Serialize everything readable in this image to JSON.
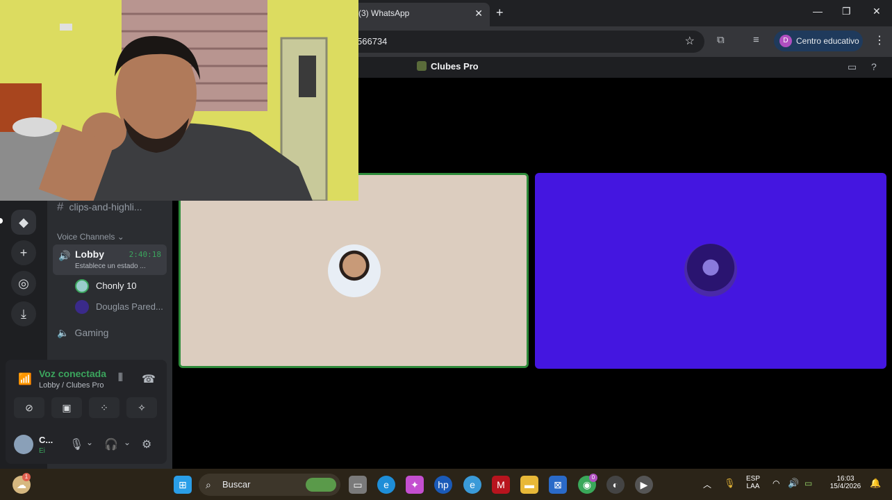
{
  "browser": {
    "tab_title": "(3) WhatsApp",
    "tab_close": "✕",
    "new_tab": "+",
    "url_fragment": "566734",
    "profile_label": "Centro educativo",
    "profile_initial": "D",
    "window_min": "—",
    "window_max": "❐",
    "window_close": "✕"
  },
  "discord": {
    "server_name": "Clubes Pro",
    "channels": {
      "text_channel": "clips-and-highli...",
      "section_label": "Voice Channels",
      "lobby": {
        "name": "Lobby",
        "timer": "2:40:18",
        "status": "Establece un estado ..."
      },
      "members": [
        "Chonly 10",
        "Douglas Pared..."
      ],
      "gaming": "Gaming"
    },
    "voice_panel": {
      "title": "Voz conectada",
      "subtitle": "Lobby / Clubes Pro"
    },
    "user": {
      "name": "C...",
      "status": "Ei"
    },
    "colors": {
      "speaking": "#3ba55d",
      "tile_b_bg": "#4416e0",
      "tile_a_bg": "#dccdbf"
    }
  },
  "taskbar": {
    "search_placeholder": "Buscar",
    "language_top": "ESP",
    "language_bottom": "LAA",
    "time": "16:03",
    "date": "15/4/2026",
    "notification_badge": "1",
    "chrome_badge": "0"
  }
}
